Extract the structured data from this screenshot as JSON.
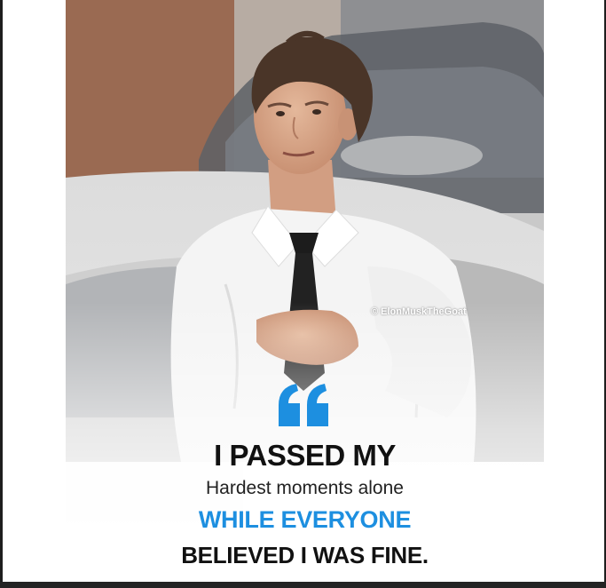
{
  "poster": {
    "watermark": "© ElonMuskTheGoat",
    "quote_line1": "I PASSED MY",
    "quote_line2": "Hardest moments alone",
    "quote_line3": "WHILE EVERYONE",
    "quote_line4": "BELIEVED I WAS FINE.",
    "accent_color": "#1d8fe0",
    "quote_icon": "double-quote-icon"
  }
}
